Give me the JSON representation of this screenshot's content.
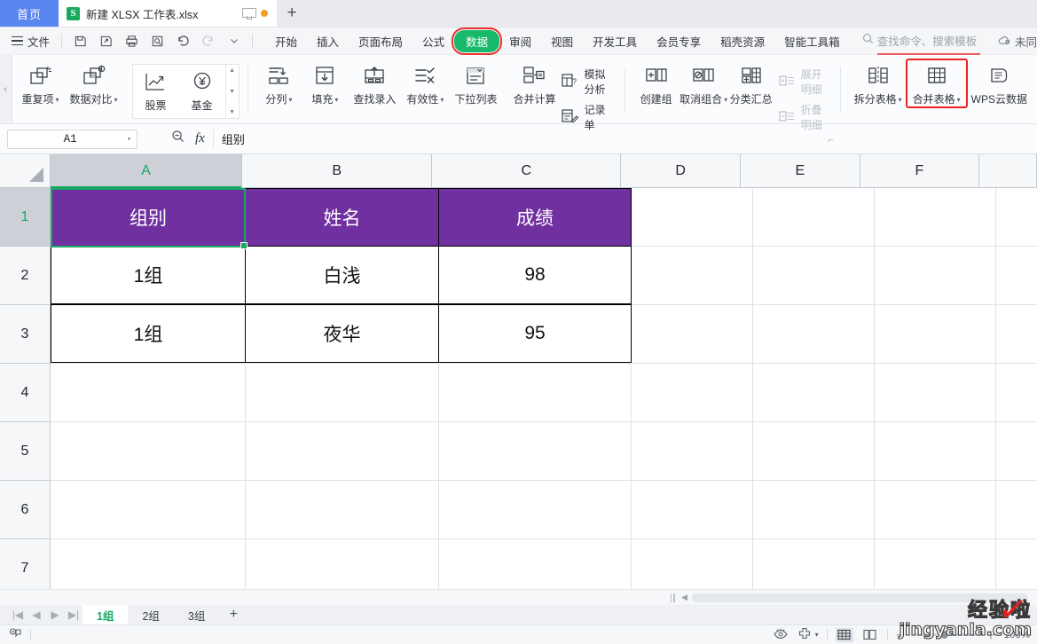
{
  "titlebar": {
    "home_tab": "首页",
    "doc_title": "新建 XLSX 工作表.xlsx",
    "badge": "S",
    "new_tab": "+",
    "icons": {
      "monitor": "monitor-icon",
      "unsaved_dot": "unsaved-dot-icon"
    }
  },
  "menubar": {
    "file": "文件",
    "quick_access": [
      "save-icon",
      "save-as-icon",
      "print-icon",
      "print-preview-icon",
      "undo-icon",
      "redo-icon",
      "customize-caret-icon"
    ],
    "tabs": [
      {
        "label": "开始",
        "active": false
      },
      {
        "label": "插入",
        "active": false
      },
      {
        "label": "页面布局",
        "active": false
      },
      {
        "label": "公式",
        "active": false
      },
      {
        "label": "数据",
        "active": true,
        "highlighted": true
      },
      {
        "label": "审阅",
        "active": false
      },
      {
        "label": "视图",
        "active": false
      },
      {
        "label": "开发工具",
        "active": false
      },
      {
        "label": "会员专享",
        "active": false
      },
      {
        "label": "稻壳资源",
        "active": false
      },
      {
        "label": "智能工具箱",
        "active": false
      }
    ],
    "search_placeholder": "查找命令、搜索模板",
    "sync_status": "未同",
    "accent_green": "#17b96a",
    "highlight_red": "#ef2d2d"
  },
  "ribbon": {
    "groups": [
      {
        "name": "duplicates",
        "items": [
          {
            "label": "重复项",
            "icon": "duplicate-items-icon",
            "caret": true,
            "disabled": false
          },
          {
            "label": "数据对比",
            "icon": "data-compare-icon",
            "caret": true,
            "disabled": false
          }
        ]
      },
      {
        "name": "finance-gallery",
        "gallery": [
          {
            "label": "股票",
            "icon": "stock-chart-icon"
          },
          {
            "label": "基金",
            "icon": "fund-yen-icon"
          }
        ],
        "spinner": [
          "▲",
          "▼",
          "▼"
        ]
      },
      {
        "name": "data-tools",
        "items": [
          {
            "label": "分列",
            "icon": "text-to-columns-icon",
            "caret": true,
            "disabled": false
          },
          {
            "label": "填充",
            "icon": "fill-down-icon",
            "caret": true,
            "disabled": false
          },
          {
            "label": "查找录入",
            "icon": "lookup-entry-icon",
            "caret": false,
            "disabled": false
          },
          {
            "label": "有效性",
            "icon": "data-validation-icon",
            "caret": true,
            "disabled": false
          },
          {
            "label": "下拉列表",
            "icon": "dropdown-list-icon",
            "caret": false,
            "disabled": false
          }
        ]
      },
      {
        "name": "consolidate",
        "items": [
          {
            "label": "合并计算",
            "icon": "consolidate-icon",
            "caret": false,
            "disabled": false
          }
        ],
        "stacked": [
          {
            "label": "模拟分析",
            "icon": "what-if-analysis-icon",
            "disabled": false
          },
          {
            "label": "记录单",
            "icon": "record-form-icon",
            "disabled": false
          }
        ]
      },
      {
        "name": "outline",
        "items": [
          {
            "label": "创建组",
            "icon": "group-icon",
            "caret": false,
            "disabled": false
          },
          {
            "label": "取消组合",
            "icon": "ungroup-icon",
            "caret": true,
            "disabled": false
          },
          {
            "label": "分类汇总",
            "icon": "subtotal-icon",
            "caret": false,
            "disabled": false
          }
        ],
        "stacked": [
          {
            "label": "展开明细",
            "icon": "expand-detail-icon",
            "disabled": true
          },
          {
            "label": "折叠明细",
            "icon": "collapse-detail-icon",
            "disabled": true
          }
        ]
      },
      {
        "name": "tables",
        "items": [
          {
            "label": "拆分表格",
            "icon": "split-table-icon",
            "caret": true,
            "disabled": false,
            "highlighted": false
          },
          {
            "label": "合并表格",
            "icon": "merge-table-icon",
            "caret": true,
            "disabled": false,
            "highlighted": true
          },
          {
            "label": "WPS云数据",
            "icon": "wps-cloud-data-icon",
            "caret": false,
            "disabled": false
          }
        ]
      }
    ]
  },
  "formulabar": {
    "name_box": "A1",
    "name_box_caret": "▾",
    "zoom_icon": "zoom-out-icon",
    "fx_icon": "fx",
    "formula_value": "组别"
  },
  "grid": {
    "columns": [
      "A",
      "B",
      "C",
      "D",
      "E",
      "F"
    ],
    "selected_column": "A",
    "rows": [
      "1",
      "2",
      "3",
      "4",
      "5",
      "6",
      "7"
    ],
    "selected_row": "1",
    "selected_cell": "A1",
    "header_fill": "#7030a0",
    "selection_color": "#1aa863",
    "table": {
      "headers": [
        "组别",
        "姓名",
        "成绩"
      ],
      "data": [
        [
          "1组",
          "白浅",
          "98"
        ],
        [
          "1组",
          "夜华",
          "95"
        ]
      ]
    }
  },
  "sheetbar": {
    "nav": [
      "|◀",
      "◀",
      "▶",
      "▶|"
    ],
    "tabs": [
      {
        "label": "1组",
        "active": true
      },
      {
        "label": "2组",
        "active": false
      },
      {
        "label": "3组",
        "active": false
      }
    ],
    "add": "+"
  },
  "statusbar": {
    "left_icons": [
      "record-macro-icon"
    ],
    "right_icons": [
      "eye-icon",
      "move-icon",
      "normal-view-icon",
      "page-layout-icon"
    ],
    "zoom_label": "100%",
    "zoom_minus": "－",
    "zoom_plus": "＋"
  },
  "watermark": {
    "cn": "经验啦",
    "en": "jingyanla.com",
    "check": "✓"
  }
}
